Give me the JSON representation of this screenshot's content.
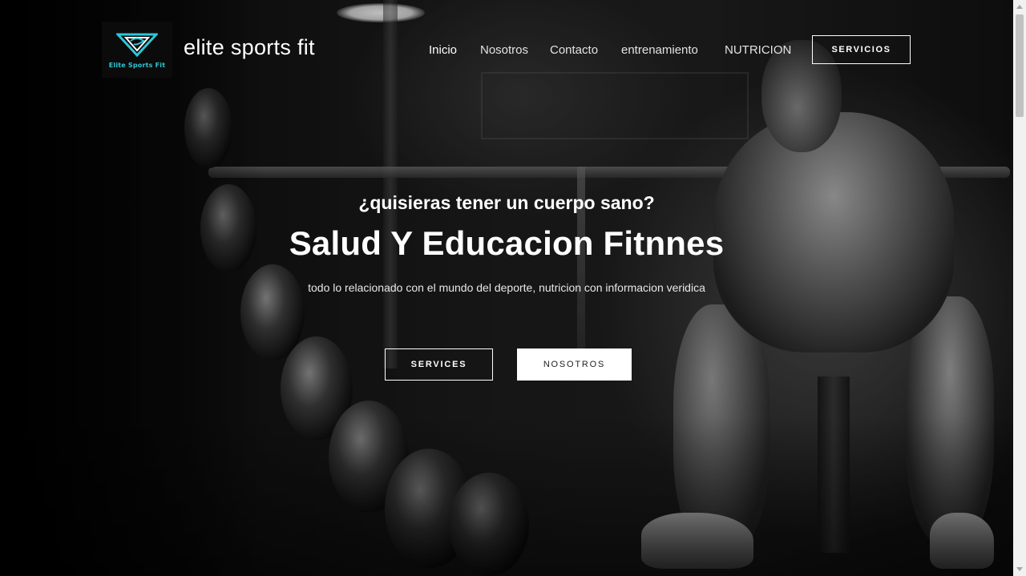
{
  "logo": {
    "text": "Elite Sports Fit",
    "accent_color": "#2fc6d6",
    "icon": "elite-sports-fit-logo-icon"
  },
  "brand": "elite sports fit",
  "nav": {
    "items": [
      {
        "label": "Inicio",
        "active": true
      },
      {
        "label": "Nosotros",
        "active": false
      },
      {
        "label": "Contacto",
        "active": false
      },
      {
        "label": "entrenamiento",
        "active": false
      },
      {
        "label": "NUTRICION",
        "active": false
      }
    ],
    "cta": "SERVICIOS"
  },
  "hero": {
    "subtitle": "¿quisieras tener un cuerpo sano?",
    "title": "Salud Y Educacion Fitnnes",
    "description": "todo lo relacionado con el mundo del deporte, nutricion con informacion veridica",
    "primary_button": "SERVICES",
    "secondary_button": "NOSOTROS"
  }
}
